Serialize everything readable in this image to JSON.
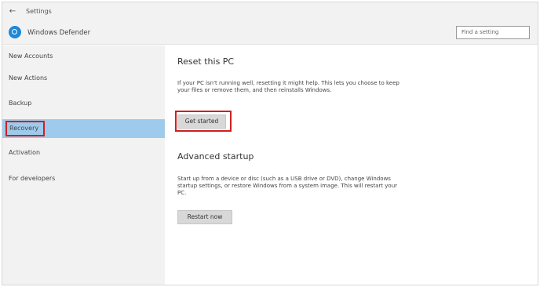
{
  "window": {
    "back_glyph": "←",
    "title": "Settings"
  },
  "app": {
    "name": "Windows Defender"
  },
  "search": {
    "placeholder": "Find a setting"
  },
  "sidebar": {
    "items": [
      {
        "label": "New Accounts"
      },
      {
        "label": "New Actions"
      },
      {
        "label": "Backup"
      },
      {
        "label": "Recovery"
      },
      {
        "label": "Activation"
      },
      {
        "label": "For developers"
      }
    ],
    "selected_index": 3
  },
  "main": {
    "section1": {
      "title": "Reset this PC",
      "description": "If your PC isn't running well, resetting it might help. This lets you choose to keep your files or remove them, and then reinstalls Windows.",
      "button_label": "Get started"
    },
    "section2": {
      "title": "Advanced startup",
      "description": "Start up from a device or disc (such as a USB drive or DVD), change Windows startup settings, or restore Windows from a system image. This will restart your PC.",
      "button_label": "Restart now"
    }
  },
  "colors": {
    "accent": "#1e88d7",
    "selected_bg": "#9ecbec",
    "highlight_border": "#d01f1f"
  }
}
